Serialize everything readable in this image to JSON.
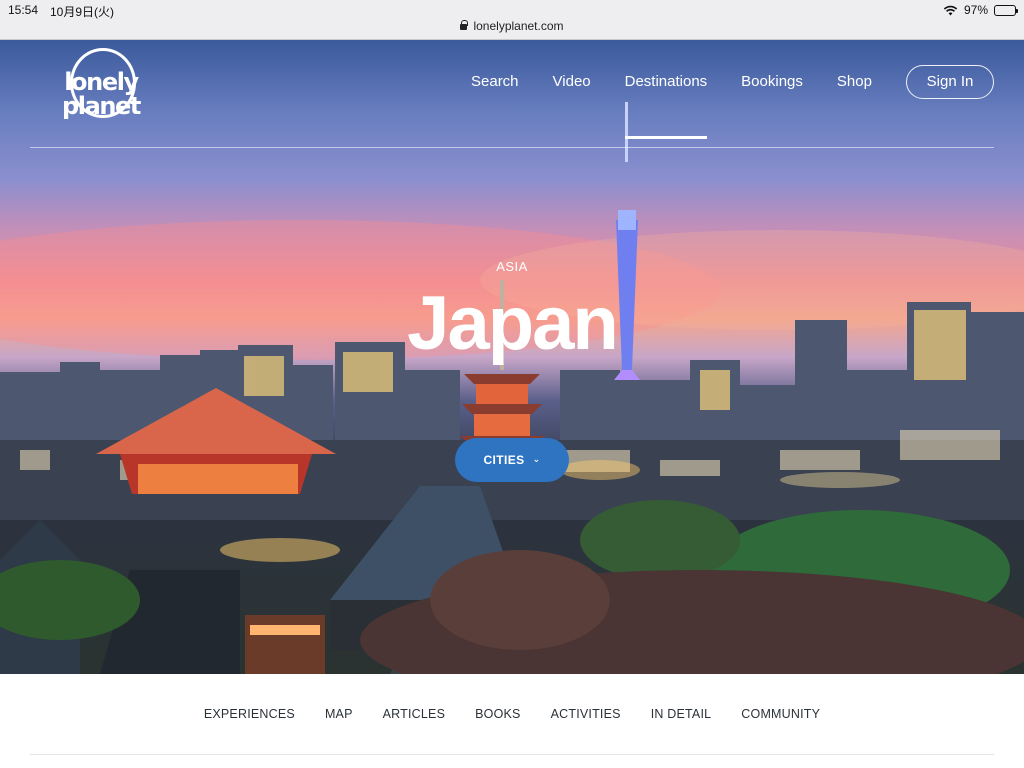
{
  "status_bar": {
    "time": "15:54",
    "date": "10月9日(火)",
    "url": "lonelyplanet.com",
    "battery": "97%"
  },
  "header": {
    "logo": "lonely planet",
    "nav": [
      {
        "label": "Search"
      },
      {
        "label": "Video"
      },
      {
        "label": "Destinations"
      },
      {
        "label": "Bookings"
      },
      {
        "label": "Shop"
      }
    ],
    "active_nav": "Destinations",
    "signin_label": "Sign In"
  },
  "hero": {
    "region": "ASIA",
    "title": "Japan",
    "cities_button": "CITIES",
    "button_color": "#2f74c0"
  },
  "subnav": {
    "items": [
      "EXPERIENCES",
      "MAP",
      "ARTICLES",
      "BOOKS",
      "ACTIVITIES",
      "IN DETAIL",
      "COMMUNITY"
    ]
  },
  "icons": [
    "lock-icon",
    "wifi-icon",
    "battery-icon",
    "chevron-down-icon"
  ]
}
